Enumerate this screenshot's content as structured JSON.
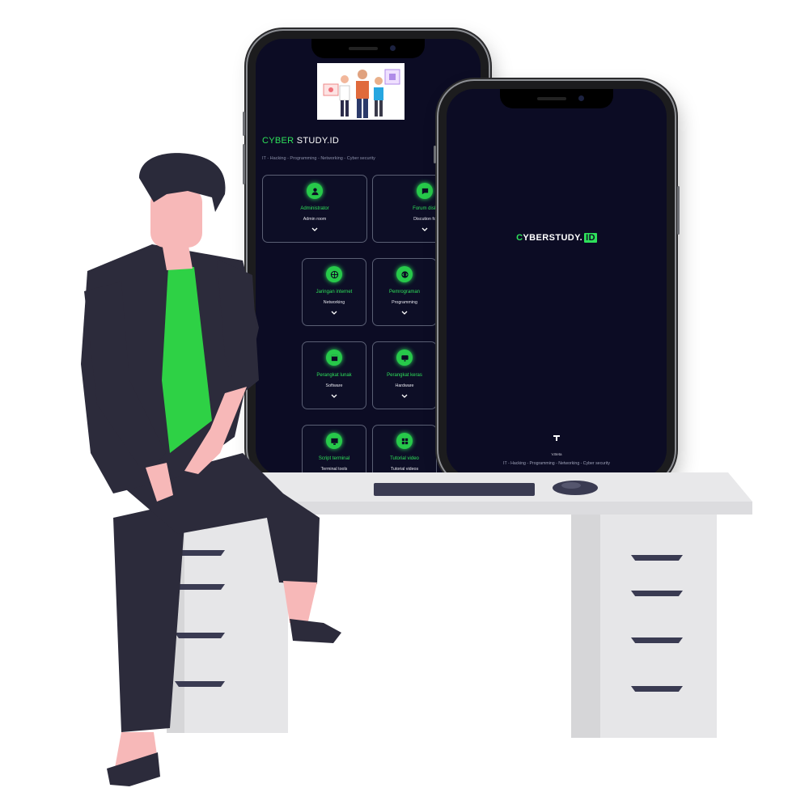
{
  "colors": {
    "accent": "#2ee05a",
    "screen_bg": "#0c0c24",
    "shirt": "#2ed145",
    "clothes": "#2c2b3b",
    "skin": "#f7b8b8",
    "hair": "#2a2a3a",
    "desk": "#e8e8ea"
  },
  "phone_home": {
    "title_accent": "CYBER",
    "title_rest": " STUDY.ID",
    "subtitle": "IT - Hacking - Programming - Networking - Cyber security",
    "cards": [
      {
        "title": "Administrator",
        "subtitle": "Admin room",
        "icon": "user-icon"
      },
      {
        "title": "Forum disk",
        "subtitle": "Discution fo",
        "icon": "chat-icon"
      },
      {
        "title": "Jaringan internet",
        "subtitle": "Networking",
        "icon": "globe-icon"
      },
      {
        "title": "Pemrograman",
        "subtitle": "Programming",
        "icon": "code-icon"
      },
      {
        "title": "Perangkat lunak",
        "subtitle": "Software",
        "icon": "window-icon"
      },
      {
        "title": "Perangkat keras",
        "subtitle": "Hardware",
        "icon": "monitor-icon"
      },
      {
        "title": "Script terminal",
        "subtitle": "Terminal tools",
        "icon": "terminal-icon"
      },
      {
        "title": "Tutorial video",
        "subtitle": "Tutorial videos",
        "icon": "grid-icon"
      }
    ]
  },
  "phone_splash": {
    "logo_c": "C",
    "logo_rest": "YBERSTUDY.",
    "logo_id": "ID",
    "version": "V.Beta",
    "tagline": "IT - Hacking - Programming - Networking - Cyber security"
  }
}
